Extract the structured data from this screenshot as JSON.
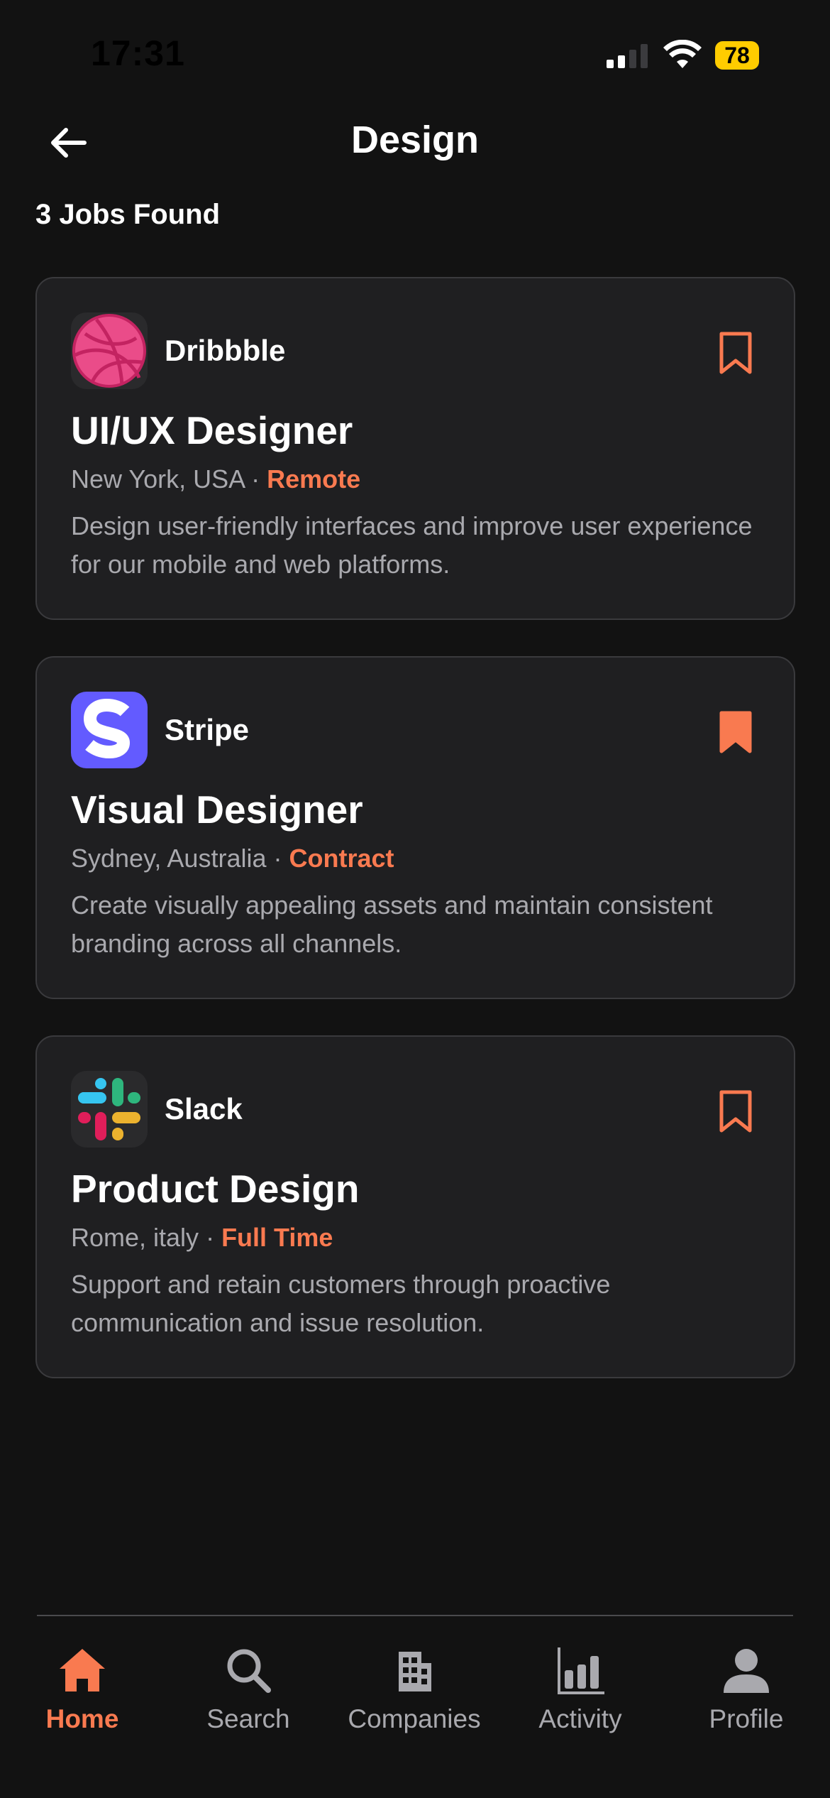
{
  "status_bar": {
    "time": "17:31",
    "battery": "78"
  },
  "header": {
    "title": "Design",
    "results_count": "3 Jobs Found"
  },
  "jobs": [
    {
      "company": "Dribbble",
      "logo_icon": "dribbble-logo",
      "title": "UI/UX Designer",
      "location": "New York, USA",
      "separator": " · ",
      "type": "Remote",
      "description": "Design user-friendly interfaces and improve user experience for our mobile and web platforms.",
      "bookmarked": false
    },
    {
      "company": "Stripe",
      "logo_icon": "stripe-logo",
      "title": "Visual Designer",
      "location": "Sydney, Australia",
      "separator": " · ",
      "type": "Contract",
      "description": "Create visually appealing assets and maintain consistent branding across all channels.",
      "bookmarked": true
    },
    {
      "company": "Slack",
      "logo_icon": "slack-logo",
      "title": "Product Design",
      "location": "Rome, italy",
      "separator": " · ",
      "type": "Full Time",
      "description": "Support and retain customers through proactive communication and issue resolution.",
      "bookmarked": false
    }
  ],
  "bottom_nav": {
    "items": [
      {
        "label": "Home",
        "icon": "home-icon",
        "active": true
      },
      {
        "label": "Search",
        "icon": "search-icon",
        "active": false
      },
      {
        "label": "Companies",
        "icon": "building-icon",
        "active": false
      },
      {
        "label": "Activity",
        "icon": "bar-chart-icon",
        "active": false
      },
      {
        "label": "Profile",
        "icon": "person-icon",
        "active": false
      }
    ]
  },
  "colors": {
    "background": "#121212",
    "card": "#1f1f21",
    "accent": "#f97a50",
    "muted_text": "#a9a9ae"
  }
}
